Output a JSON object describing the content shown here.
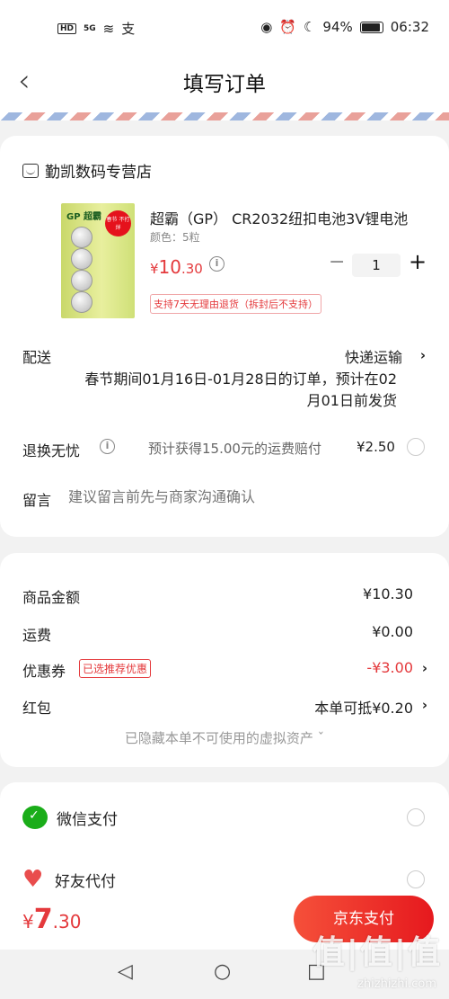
{
  "status": {
    "hd": "HD",
    "sig": "5G",
    "pay": "支",
    "battery": "94%",
    "time": "06:32"
  },
  "nav": {
    "title": "填写订单",
    "back": "‹"
  },
  "shop": {
    "name": "勤凯数码专营店"
  },
  "product": {
    "name": "超霸（GP） CR2032纽扣电池3V锂电池",
    "spec": "颜色：5粒",
    "price_symbol": "¥",
    "price_int": "10",
    "price_dec": ".30",
    "quantity": "1",
    "return_policy": "支持7天无理由退货（拆封后不支持）",
    "image_brand": "GP 超霸",
    "badge": "春节 不打烊"
  },
  "delivery": {
    "label": "配送",
    "method": "快递运输",
    "note": "春节期间01月16日-01月28日的订单，预计在02月01日前发货"
  },
  "returns": {
    "label": "退换无忧",
    "text": "预计获得15.00元的运费赔付",
    "price": "¥2.50"
  },
  "message": {
    "label": "留言",
    "placeholder": "建议留言前先与商家沟通确认"
  },
  "summary": {
    "goods_label": "商品金额",
    "goods_value": "¥10.30",
    "shipping_label": "运费",
    "shipping_value": "¥0.00",
    "coupon_label": "优惠券",
    "coupon_tag": "已选推荐优惠",
    "coupon_value": "-¥3.00",
    "redpacket_label": "红包",
    "redpacket_value": "本单可抵¥0.20",
    "hidden_assets": "已隐藏本单不可使用的虚拟资产 ˇ"
  },
  "payment": {
    "wechat": "微信支付",
    "friend": "好友代付"
  },
  "bottom": {
    "total_symbol": "¥",
    "total_int": "7",
    "total_dec": ".30",
    "pay_button": "京东支付"
  },
  "watermark": {
    "main": "值|值|值",
    "sub": "zhizhizhi.com"
  },
  "colors": {
    "accent": "#e4393c",
    "wechat": "#1aad19"
  }
}
